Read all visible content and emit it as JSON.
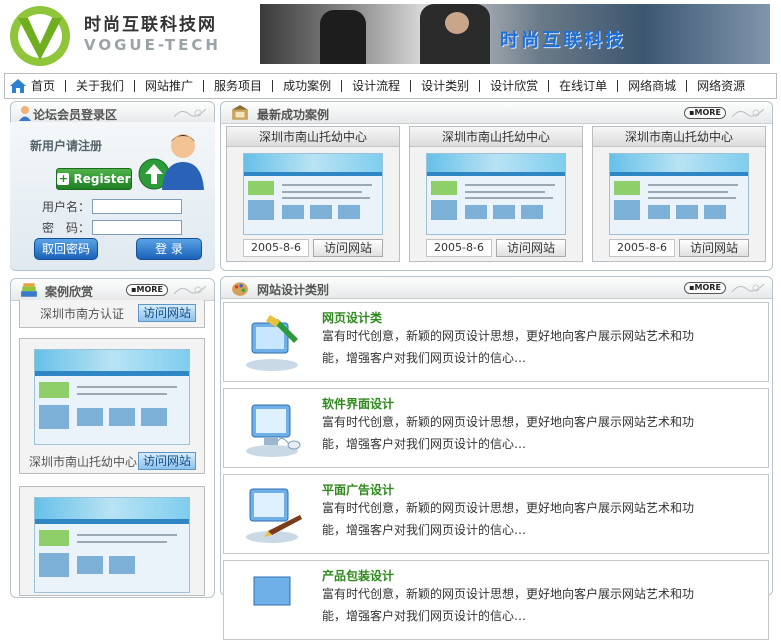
{
  "header": {
    "logo_cn": "时尚互联科技网",
    "logo_en": "VOGUE-TECH",
    "banner_text": "时尚互联科技"
  },
  "nav": {
    "items": [
      "首页",
      "关于我们",
      "网站推广",
      "服务项目",
      "成功案例",
      "设计流程",
      "设计类别",
      "设计欣赏",
      "在线订单",
      "网络商城",
      "网络资源"
    ]
  },
  "login": {
    "title": "论坛会员登录区",
    "new_user": "新用户请注册",
    "register": "Register",
    "username_label": "用户名：",
    "password_label": "密　码：",
    "retrieve_btn": "取回密码",
    "login_btn": "登 录"
  },
  "latest_cases": {
    "title": "最新成功案例",
    "more": "MORE",
    "items": [
      {
        "name": "深圳市南山托幼中心",
        "date": "2005-8-6",
        "visit": "访问网站"
      },
      {
        "name": "深圳市南山托幼中心",
        "date": "2005-8-6",
        "visit": "访问网站"
      },
      {
        "name": "深圳市南山托幼中心",
        "date": "2005-8-6",
        "visit": "访问网站"
      }
    ]
  },
  "showcase": {
    "title": "案例欣赏",
    "more": "MORE",
    "items": [
      {
        "name": "深圳市南方认证",
        "visit": "访问网站"
      },
      {
        "name": "深圳市南山托幼中心",
        "visit": "访问网站"
      }
    ]
  },
  "categories": {
    "title": "网站设计类别",
    "more": "MORE",
    "items": [
      {
        "name": "网页设计类",
        "desc": "富有时代创意，新颖的网页设计思想，更好地向客户展示网站艺术和功能，增强客户对我们网页设计的信心…",
        "icon": "paintbrush-monitor-icon"
      },
      {
        "name": "软件界面设计",
        "desc": "富有时代创意，新颖的网页设计思想，更好地向客户展示网站艺术和功能，增强客户对我们网页设计的信心…",
        "icon": "monitor-mouse-icon"
      },
      {
        "name": "平面广告设计",
        "desc": "富有时代创意，新颖的网页设计思想，更好地向客户展示网站艺术和功能，增强客户对我们网页设计的信心…",
        "icon": "monitor-pen-icon"
      },
      {
        "name": "产品包装设计",
        "desc": "富有时代创意，新颖的网页设计思想，更好地向客户展示网站艺术和功能，增强客户对我们网页设计的信心…",
        "icon": "package-icon"
      }
    ]
  },
  "colors": {
    "accent_green": "#2f8a1d",
    "nav_border": "#bbbbbb",
    "button_blue": "#1a62b8"
  }
}
